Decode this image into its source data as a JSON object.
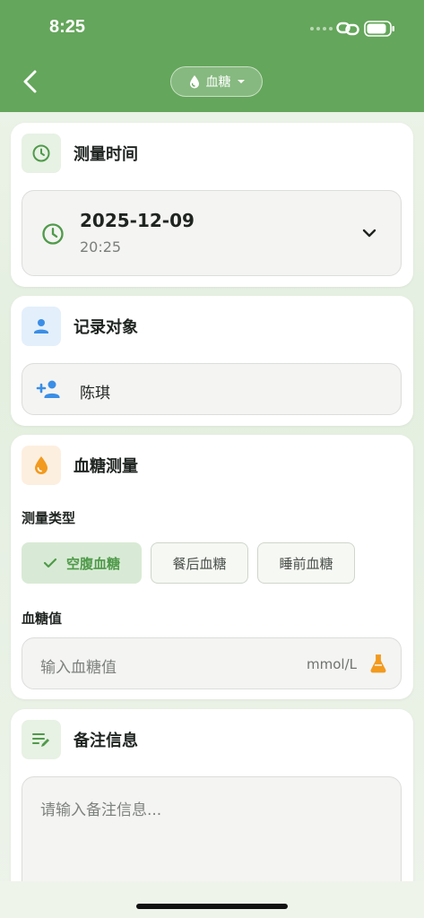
{
  "status_bar": {
    "time": "8:25"
  },
  "header": {
    "type_selector_label": "血糖"
  },
  "time_card": {
    "title": "测量时间",
    "date": "2025-12-09",
    "time": "20:25"
  },
  "subject_card": {
    "title": "记录对象",
    "subject_name": "陈琪"
  },
  "glucose_card": {
    "title": "血糖测量",
    "type_label": "测量类型",
    "types": [
      "空腹血糖",
      "餐后血糖",
      "睡前血糖"
    ],
    "selected_type": "空腹血糖",
    "value_label": "血糖值",
    "value_placeholder": "输入血糖值",
    "unit": "mmol/L"
  },
  "notes_card": {
    "title": "备注信息",
    "placeholder": "请输入备注信息..."
  },
  "colors": {
    "brand": "#64a65b",
    "accent_green": "#4f9a4a",
    "accent_blue": "#3a8ee6",
    "accent_orange": "#f29a1f"
  }
}
